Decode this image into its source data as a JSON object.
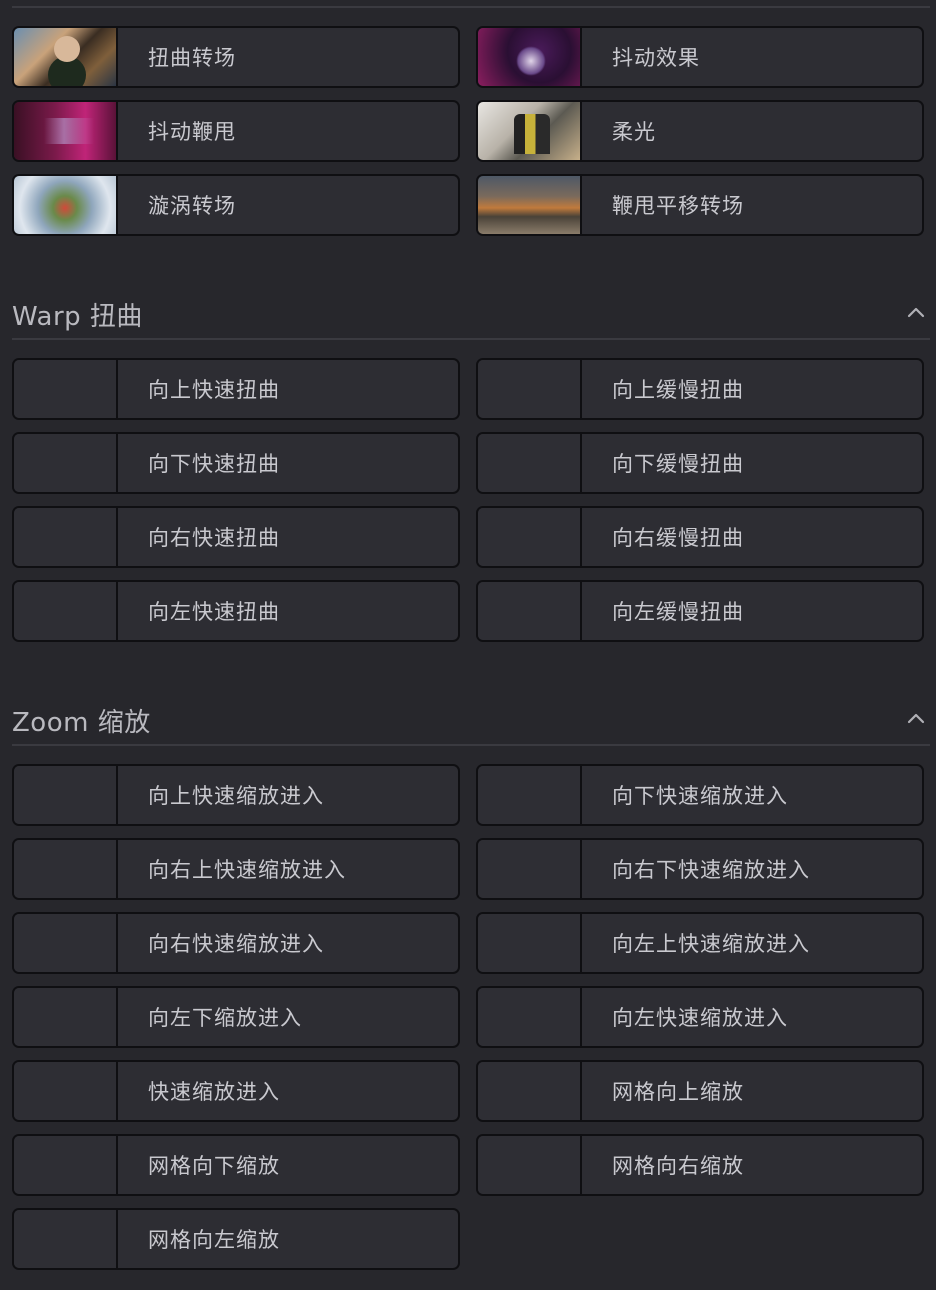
{
  "top_transitions": [
    {
      "label": "扭曲转场",
      "thumb": "twist"
    },
    {
      "label": "抖动效果",
      "thumb": "shake"
    },
    {
      "label": "抖动鞭甩",
      "thumb": "whip"
    },
    {
      "label": "柔光",
      "thumb": "soft"
    },
    {
      "label": "漩涡转场",
      "thumb": "swirl"
    },
    {
      "label": "鞭甩平移转场",
      "thumb": "pan"
    }
  ],
  "warp_section": {
    "title": "Warp 扭曲",
    "collapse_icon": "chevron-up-icon",
    "items": [
      {
        "label": "向上快速扭曲"
      },
      {
        "label": "向上缓慢扭曲"
      },
      {
        "label": "向下快速扭曲"
      },
      {
        "label": "向下缓慢扭曲"
      },
      {
        "label": "向右快速扭曲"
      },
      {
        "label": "向右缓慢扭曲"
      },
      {
        "label": "向左快速扭曲"
      },
      {
        "label": "向左缓慢扭曲"
      }
    ]
  },
  "zoom_section": {
    "title": "Zoom 缩放",
    "collapse_icon": "chevron-up-icon",
    "items": [
      {
        "label": "向上快速缩放进入"
      },
      {
        "label": "向下快速缩放进入"
      },
      {
        "label": "向右上快速缩放进入"
      },
      {
        "label": "向右下快速缩放进入"
      },
      {
        "label": "向右快速缩放进入"
      },
      {
        "label": "向左上快速缩放进入"
      },
      {
        "label": "向左下缩放进入"
      },
      {
        "label": "向左快速缩放进入"
      },
      {
        "label": "快速缩放进入"
      },
      {
        "label": "网格向上缩放"
      },
      {
        "label": "网格向下缩放"
      },
      {
        "label": "网格向右缩放"
      },
      {
        "label": "网格向左缩放"
      }
    ]
  },
  "colors": {
    "background": "#27272c",
    "tile": "#2d2d33",
    "tile_border": "#0f0f12",
    "text": "#c9c9cf",
    "heading": "#b9b9bf"
  }
}
